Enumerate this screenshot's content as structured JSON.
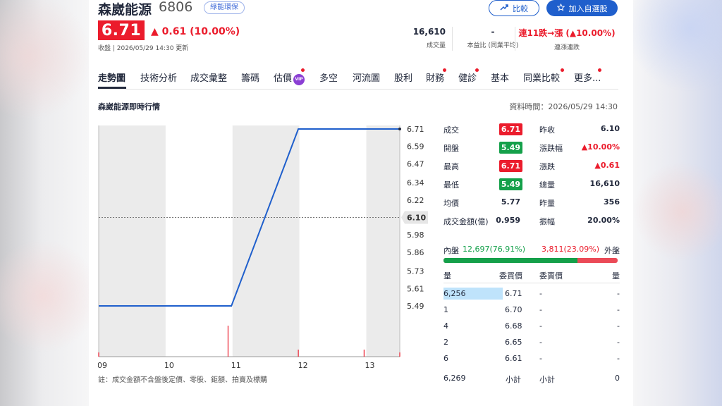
{
  "stock": {
    "name": "森崴能源",
    "code": "6806",
    "tag": "綠能環保",
    "price": "6.71",
    "change": "0.61 (10.00%)",
    "close_note": "收盤 | 2026/05/29 14:30 更新"
  },
  "buttons": {
    "compare": "比較",
    "watchlist": "加入自選股"
  },
  "stats": [
    {
      "value": "16,610",
      "label": "成交量"
    },
    {
      "value": "-",
      "label": "本益比 (同業平均)"
    },
    {
      "value": "連11跌→漲 (▲10.00%)",
      "label": "連漲連跌"
    }
  ],
  "tabs": [
    "走勢圖",
    "技術分析",
    "成交彙整",
    "籌碼",
    "估價",
    "多空",
    "河流圖",
    "股利",
    "財務",
    "健診",
    "基本",
    "同業比較",
    "更多"
  ],
  "vip_badge": "VIP",
  "section": {
    "title": "森崴能源即時行情",
    "time": "資料時間：2026/05/29 14:30"
  },
  "chart_data": {
    "type": "line",
    "x_ticks": [
      "09",
      "10",
      "11",
      "12",
      "13"
    ],
    "y_ticks": [
      "6.71",
      "6.59",
      "6.47",
      "6.34",
      "6.22",
      "6.10",
      "5.98",
      "5.86",
      "5.73",
      "5.61",
      "5.49"
    ],
    "reference_label": "6.10",
    "ylim": [
      5.49,
      6.71
    ],
    "reference": 6.1,
    "price_points": [
      {
        "t": "09:00",
        "p": 5.49
      },
      {
        "t": "10:59",
        "p": 5.49
      },
      {
        "t": "11:59",
        "p": 6.71
      },
      {
        "t": "13:30",
        "p": 6.71
      }
    ],
    "volume_bars": [
      {
        "t": "09:00",
        "v": 0.12
      },
      {
        "t": "10:56",
        "v": 0.88
      },
      {
        "t": "11:59",
        "v": 0.2
      },
      {
        "t": "12:58",
        "v": 0.2
      },
      {
        "t": "13:30",
        "v": 0.12
      }
    ],
    "grid": true
  },
  "note": "註：成交金額不含盤後定價、零股、鉅額、拍賣及標購",
  "quote": {
    "left": [
      {
        "label": "成交",
        "value": "6.71",
        "style": "badge-red"
      },
      {
        "label": "開盤",
        "value": "5.49",
        "style": "badge-green"
      },
      {
        "label": "最高",
        "value": "6.71",
        "style": "badge-red"
      },
      {
        "label": "最低",
        "value": "5.49",
        "style": "badge-green"
      },
      {
        "label": "均價",
        "value": "5.77",
        "style": "plain"
      },
      {
        "label": "成交金額(億)",
        "value": "0.959",
        "style": "plain"
      }
    ],
    "right": [
      {
        "label": "昨收",
        "value": "6.10",
        "style": "plain"
      },
      {
        "label": "漲跌幅",
        "value": "▲10.00%",
        "style": "red"
      },
      {
        "label": "漲跌",
        "value": "▲0.61",
        "style": "red"
      },
      {
        "label": "總量",
        "value": "16,610",
        "style": "plain"
      },
      {
        "label": "昨量",
        "value": "356",
        "style": "plain"
      },
      {
        "label": "振幅",
        "value": "20.00%",
        "style": "plain"
      }
    ]
  },
  "inout": {
    "inner_label": "內盤",
    "inner_value": "12,697(76.91%)",
    "outer_value": "3,811(23.09%)",
    "outer_label": "外盤",
    "inner_ratio": 0.7691
  },
  "orderbook": {
    "headers": [
      "量",
      "委買價",
      "委賣價",
      "量"
    ],
    "rows": [
      {
        "bid_qty": "6,256",
        "bid": "6.71",
        "ask": "-",
        "ask_qty": "-",
        "highlight": true
      },
      {
        "bid_qty": "1",
        "bid": "6.70",
        "ask": "-",
        "ask_qty": "-"
      },
      {
        "bid_qty": "4",
        "bid": "6.68",
        "ask": "-",
        "ask_qty": "-"
      },
      {
        "bid_qty": "2",
        "bid": "6.65",
        "ask": "-",
        "ask_qty": "-"
      },
      {
        "bid_qty": "6",
        "bid": "6.61",
        "ask": "-",
        "ask_qty": "-"
      }
    ],
    "bid_total": "6,269",
    "subtotal_label": "小計",
    "ask_total": "0"
  },
  "colors": {
    "up": "#eb1c2c",
    "down": "#14a04a",
    "line": "#1f5fcc",
    "accent": "#1f5fcc"
  }
}
